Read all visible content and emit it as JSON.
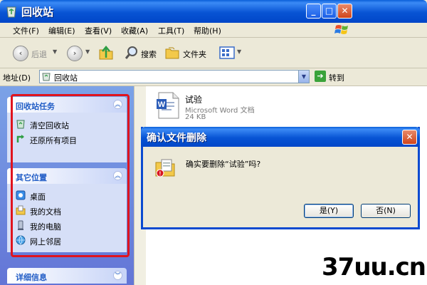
{
  "window": {
    "title": "回收站",
    "min_glyph": "_",
    "max_glyph": "□",
    "close_glyph": "✕"
  },
  "menu": {
    "items": [
      "文件(F)",
      "编辑(E)",
      "查看(V)",
      "收藏(A)",
      "工具(T)",
      "帮助(H)"
    ]
  },
  "toolbar": {
    "back_label": "后退",
    "search_label": "搜索",
    "folders_label": "文件夹"
  },
  "address": {
    "label": "地址(D)",
    "value": "回收站",
    "go_label": "转到"
  },
  "tasks": {
    "recycle_group_title": "回收站任务",
    "empty_recycle_bin": "清空回收站",
    "restore_all": "还原所有项目",
    "other_places_title": "其它位置",
    "places": [
      "桌面",
      "我的文档",
      "我的电脑",
      "网上邻居"
    ],
    "details_title": "详细信息"
  },
  "file": {
    "name": "试验",
    "type": "Microsoft Word 文档",
    "size": "24 KB"
  },
  "dialog": {
    "title": "确认文件删除",
    "message": "确实要删除“试验”吗?",
    "yes_label": "是(Y)",
    "no_label": "否(N)"
  },
  "watermark": {
    "text": "37uu.cn"
  },
  "colors": {
    "titlebar_blue": "#0854d4",
    "taskpane_blue": "#6375d6",
    "highlight_red": "#e0141e"
  }
}
